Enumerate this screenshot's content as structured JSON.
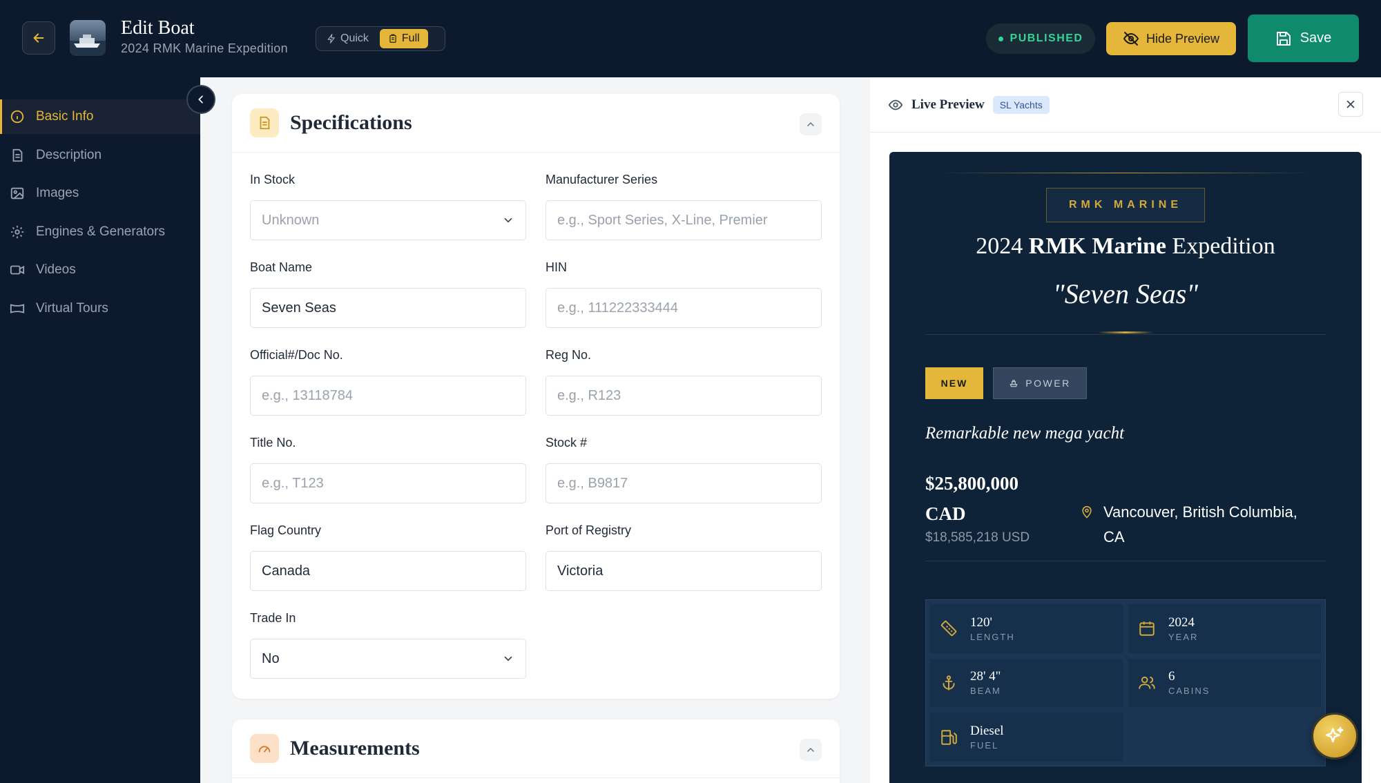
{
  "header": {
    "title": "Edit Boat",
    "subtitle": "2024 RMK Marine Expedition",
    "mode_quick": "Quick",
    "mode_full": "Full",
    "status": "PUBLISHED",
    "hide_preview_label": "Hide Preview",
    "save_label": "Save"
  },
  "sidebar": {
    "items": [
      {
        "label": "Basic Info",
        "icon": "info-icon"
      },
      {
        "label": "Description",
        "icon": "document-icon"
      },
      {
        "label": "Images",
        "icon": "image-icon"
      },
      {
        "label": "Engines & Generators",
        "icon": "gear-icon"
      },
      {
        "label": "Videos",
        "icon": "video-icon"
      },
      {
        "label": "Virtual Tours",
        "icon": "panorama-icon"
      }
    ]
  },
  "specifications": {
    "title": "Specifications",
    "fields": {
      "in_stock": {
        "label": "In Stock",
        "value": "Unknown"
      },
      "manufacturer_series": {
        "label": "Manufacturer Series",
        "placeholder": "e.g., Sport Series, X-Line, Premier"
      },
      "boat_name": {
        "label": "Boat Name",
        "value": "Seven Seas"
      },
      "hin": {
        "label": "HIN",
        "placeholder": "e.g., 111222333444"
      },
      "official_doc": {
        "label": "Official#/Doc No.",
        "placeholder": "e.g., 13118784"
      },
      "reg_no": {
        "label": "Reg No.",
        "placeholder": "e.g., R123"
      },
      "title_no": {
        "label": "Title No.",
        "placeholder": "e.g., T123"
      },
      "stock_no": {
        "label": "Stock #",
        "placeholder": "e.g., B9817"
      },
      "flag_country": {
        "label": "Flag Country",
        "value": "Canada"
      },
      "port_registry": {
        "label": "Port of Registry",
        "value": "Victoria"
      },
      "trade_in": {
        "label": "Trade In",
        "value": "No"
      }
    }
  },
  "measurements": {
    "title": "Measurements"
  },
  "preview": {
    "title": "Live Preview",
    "badge": "SL Yachts",
    "brand": "RMK MARINE",
    "listing_year": "2024",
    "listing_make": "RMK Marine",
    "listing_model": "Expedition",
    "listing_name": "\"Seven Seas\"",
    "tag_condition": "NEW",
    "tag_type": "POWER",
    "tagline": "Remarkable new mega yacht",
    "price": "$25,800,000 CAD",
    "price_usd": "$18,585,218 USD",
    "location": "Vancouver, British Columbia, CA",
    "specs": [
      {
        "value": "120'",
        "label": "LENGTH",
        "icon": "ruler-icon"
      },
      {
        "value": "2024",
        "label": "YEAR",
        "icon": "calendar-icon"
      },
      {
        "value": "28' 4\"",
        "label": "BEAM",
        "icon": "anchor-icon"
      },
      {
        "value": "6",
        "label": "CABINS",
        "icon": "users-icon"
      },
      {
        "value": "Diesel",
        "label": "FUEL",
        "icon": "fuel-pump-icon"
      }
    ]
  },
  "colors": {
    "navy": "#0d1a2d",
    "gold": "#e4b73a",
    "green": "#0f8a6c",
    "published": "#34d399"
  }
}
